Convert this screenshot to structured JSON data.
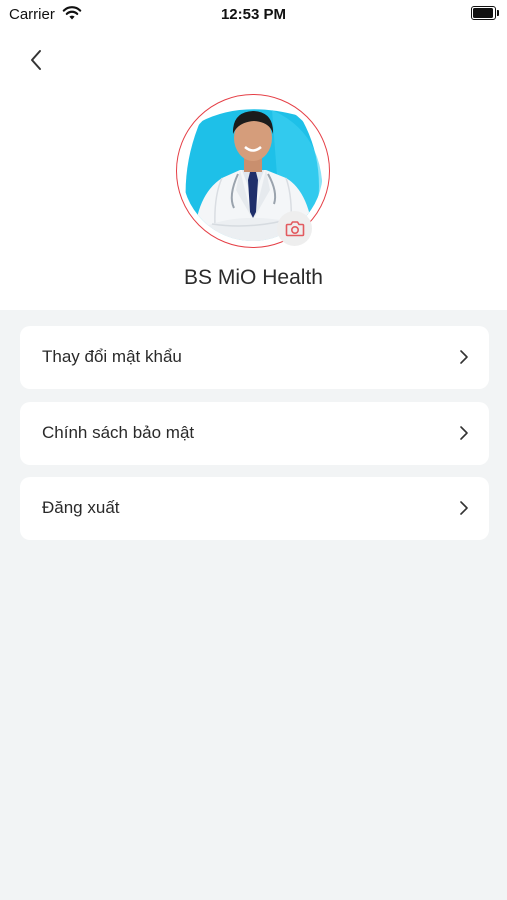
{
  "status_bar": {
    "carrier": "Carrier",
    "time": "12:53 PM"
  },
  "icons": {
    "back": "chevron-left-icon",
    "camera": "camera-icon",
    "item_arrow": "chevron-right-icon",
    "wifi": "wifi-icon",
    "battery": "battery-icon"
  },
  "profile": {
    "name": "BS MiO Health"
  },
  "menu": {
    "items": [
      {
        "label": "Thay đổi mật khẩu"
      },
      {
        "label": "Chính sách bảo mật"
      },
      {
        "label": "Đăng xuất"
      }
    ]
  },
  "colors": {
    "avatar_ring": "#e53f46",
    "camera_icon": "#e25a5f",
    "avatar_bg": "#1ec0e8",
    "page_bg": "#f2f4f5"
  }
}
